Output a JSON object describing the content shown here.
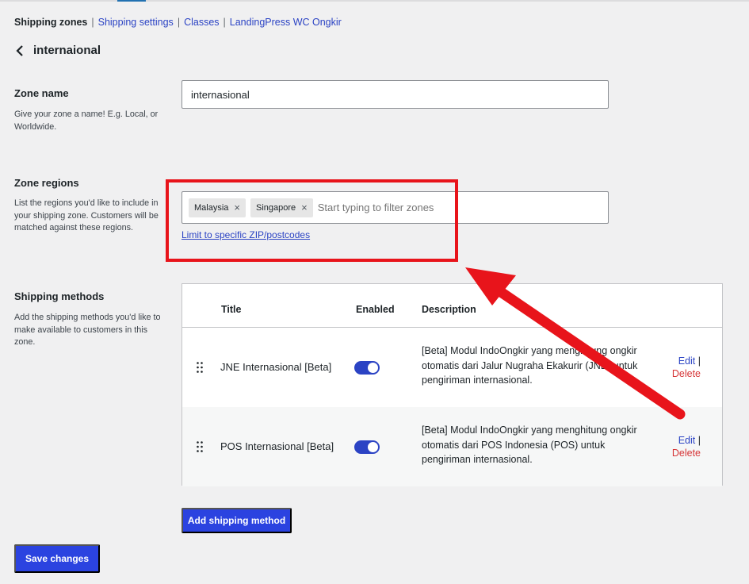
{
  "nav": {
    "current": "Shipping zones",
    "separator": "|",
    "links": [
      "Shipping settings",
      "Classes",
      "LandingPress WC Ongkir"
    ]
  },
  "zone": {
    "back_title": "internaional",
    "name_label": "Zone name",
    "name_desc": "Give your zone a name! E.g. Local, or Worldwide.",
    "name_value": "internasional",
    "regions_label": "Zone regions",
    "regions_desc": "List the regions you'd like to include in your shipping zone. Customers will be matched against these regions.",
    "regions": [
      "Malaysia",
      "Singapore"
    ],
    "remove_glyph": "×",
    "regions_placeholder": "Start typing to filter zones",
    "zip_link": "Limit to specific ZIP/postcodes"
  },
  "methods": {
    "label": "Shipping methods",
    "desc": "Add the shipping methods you'd like to make available to customers in this zone.",
    "columns": {
      "title": "Title",
      "enabled": "Enabled",
      "description": "Description"
    },
    "rows": [
      {
        "title": "JNE Internasional [Beta]",
        "enabled": true,
        "description": "[Beta] Modul IndoOngkir yang menghitung ongkir otomatis dari Jalur Nugraha Ekakurir (JNE) untuk pengiriman internasional.",
        "edit": "Edit",
        "pipe": "|",
        "delete": "Delete"
      },
      {
        "title": "POS Internasional [Beta]",
        "enabled": true,
        "description": "[Beta] Modul IndoOngkir yang menghitung ongkir otomatis dari POS Indonesia (POS) untuk pengiriman internasional.",
        "edit": "Edit",
        "pipe": "|",
        "delete": "Delete"
      }
    ],
    "add_button": "Add shipping method"
  },
  "save_button": "Save changes",
  "colors": {
    "primary": "#2b43e0",
    "link": "#2b43c4",
    "delete": "#d63638",
    "annotation": "#e8141b",
    "background": "#f0f0f1"
  }
}
